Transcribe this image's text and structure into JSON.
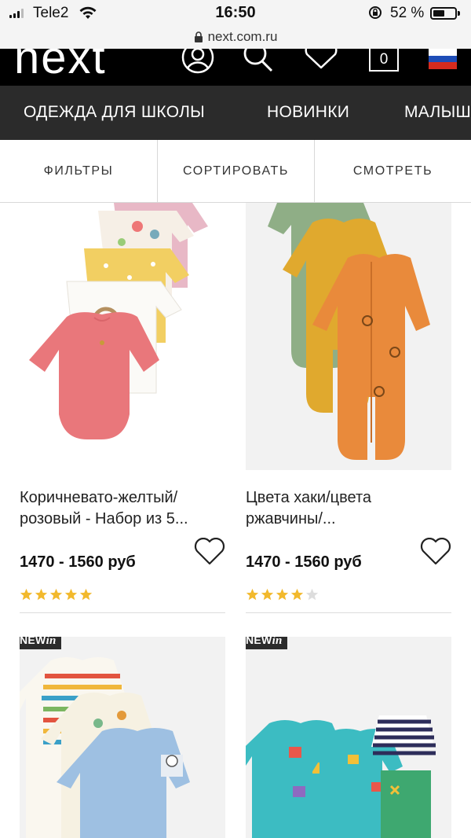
{
  "status_bar": {
    "carrier": "Tele2",
    "time": "16:50",
    "battery": "52 %",
    "battery_level": 0.52
  },
  "browser": {
    "url": "next.com.ru"
  },
  "header": {
    "logo": "next",
    "bag_count": "0"
  },
  "category_nav": [
    "ОДЕЖДА ДЛЯ ШКОЛЫ",
    "НОВИНКИ",
    "МАЛЫШ"
  ],
  "filters": [
    "ФИЛЬТРЫ",
    "СОРТИРОВАТЬ",
    "СМОТРЕТЬ"
  ],
  "products": [
    {
      "title_line1": "Коричневато-желтый/",
      "title_line2": "розовый - Набор из 5...",
      "price": "1470 - 1560 руб",
      "rating": 5
    },
    {
      "title_line1": "Цвета хаки/цвета",
      "title_line2": "ржавчины/...",
      "price": "1470 - 1560 руб",
      "rating": 4
    },
    {
      "badge_a": "NEW",
      "badge_b": "in"
    },
    {
      "badge_a": "NEW",
      "badge_b": "in"
    }
  ],
  "colors": {
    "header_bg": "#000000",
    "nav_bg": "#2b2b2b",
    "star_gold": "#f2b92d",
    "star_empty": "#dddddd",
    "badge_bg": "#2c2c2c"
  }
}
